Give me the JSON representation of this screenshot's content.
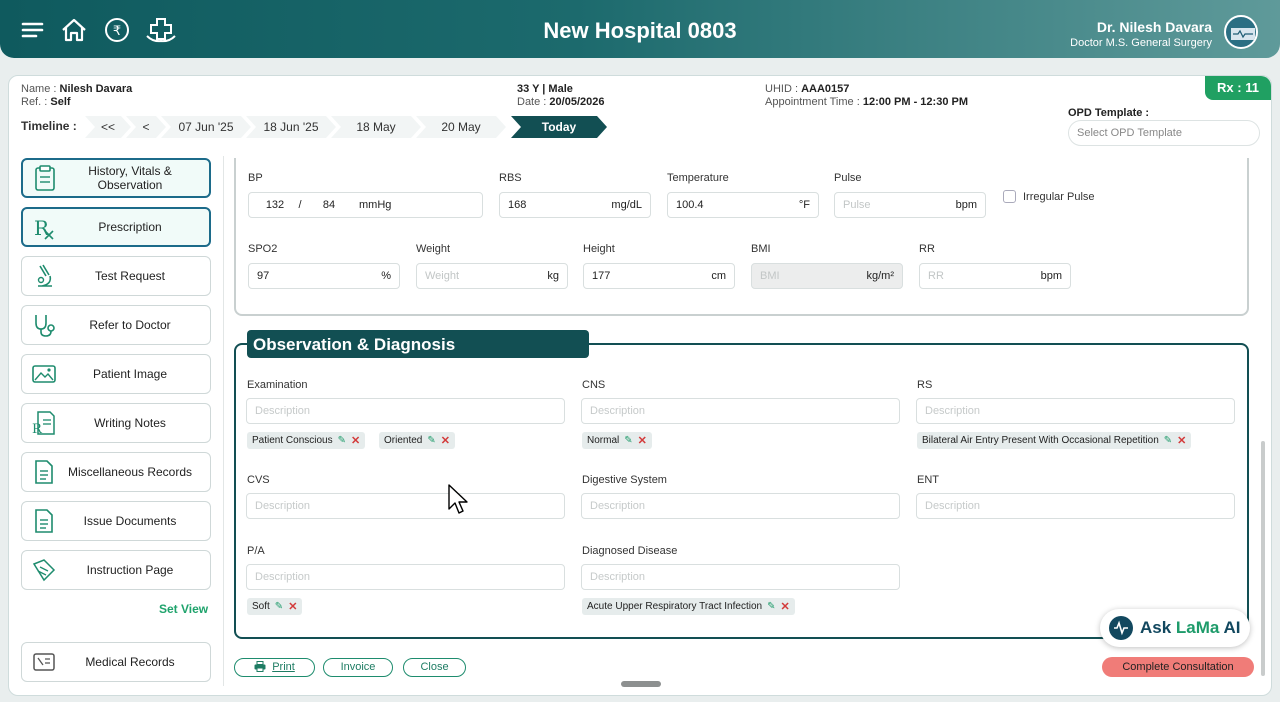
{
  "header": {
    "hospital_name": "New Hospital 0803",
    "doctor_name": "Dr. Nilesh Davara",
    "doctor_title": "Doctor M.S. General Surgery",
    "icons": [
      "menu-icon",
      "home-icon",
      "rupee-icon",
      "health-icon"
    ]
  },
  "patient": {
    "name_label": "Name :",
    "name": "Nilesh Davara",
    "ref_label": "Ref. :",
    "ref": "Self",
    "age_gender": "33 Y | Male",
    "date_label": "Date :",
    "date": "20/05/2026",
    "uhid_label": "UHID :",
    "uhid": "AAA0157",
    "appt_label": "Appointment Time :",
    "appt_time": "12:00 PM - 12:30 PM",
    "rx": "Rx : 11"
  },
  "timeline": {
    "label": "Timeline :",
    "items": [
      "<<",
      "<",
      "07 Jun '25",
      "18 Jun '25",
      "18 May",
      "20 May",
      "Today"
    ]
  },
  "opd_template": {
    "label": "OPD Template :",
    "placeholder": "Select OPD Template"
  },
  "sidebar": {
    "items": [
      {
        "label": "History, Vitals & Observation",
        "icon": "clipboard-icon"
      },
      {
        "label": "Prescription",
        "icon": "rx-icon"
      },
      {
        "label": "Test Request",
        "icon": "microscope-icon"
      },
      {
        "label": "Refer to Doctor",
        "icon": "stethoscope-icon"
      },
      {
        "label": "Patient Image",
        "icon": "image-icon"
      },
      {
        "label": "Writing Notes",
        "icon": "rx-notes-icon"
      },
      {
        "label": "Miscellaneous Records",
        "icon": "document-icon"
      },
      {
        "label": "Issue Documents",
        "icon": "document-icon"
      },
      {
        "label": "Instruction Page",
        "icon": "instruction-icon"
      }
    ],
    "set_view": "Set View",
    "medical_records": "Medical Records"
  },
  "vitals": {
    "bp_label": "BP",
    "bp_sys": "132",
    "bp_sep": "/",
    "bp_dia": "84",
    "bp_unit": "mmHg",
    "rbs_label": "RBS",
    "rbs": "168",
    "rbs_unit": "mg/dL",
    "temp_label": "Temperature",
    "temp": "100.4",
    "temp_unit": "°F",
    "pulse_label": "Pulse",
    "pulse_ph": "Pulse",
    "pulse_unit": "bpm",
    "irregular": "Irregular Pulse",
    "spo2_label": "SPO2",
    "spo2": "97",
    "spo2_unit": "%",
    "weight_label": "Weight",
    "weight_ph": "Weight",
    "weight_unit": "kg",
    "height_label": "Height",
    "height": "177",
    "height_unit": "cm",
    "bmi_label": "BMI",
    "bmi_ph": "BMI",
    "bmi_unit": "kg/m²",
    "rr_label": "RR",
    "rr_ph": "RR",
    "rr_unit": "bpm"
  },
  "observation": {
    "title": "Observation & Diagnosis",
    "placeholder": "Description",
    "examination": {
      "label": "Examination",
      "tags": [
        "Patient Conscious",
        "Oriented"
      ]
    },
    "cns": {
      "label": "CNS",
      "tags": [
        "Normal"
      ]
    },
    "rs": {
      "label": "RS",
      "tags": [
        "Bilateral Air Entry Present With Occasional Repetition"
      ]
    },
    "cvs": {
      "label": "CVS"
    },
    "digestive": {
      "label": "Digestive System"
    },
    "ent": {
      "label": "ENT"
    },
    "pa": {
      "label": "P/A",
      "tags": [
        "Soft"
      ]
    },
    "diagnosed": {
      "label": "Diagnosed Disease",
      "tags": [
        "Acute Upper Respiratory Tract Infection"
      ]
    }
  },
  "footer": {
    "print": "Print",
    "invoice": "Invoice",
    "close": "Close",
    "complete": "Complete Consultation",
    "ask_lama": "Ask ",
    "lama_brand": "LaMa",
    "lama_ai": " AI"
  }
}
